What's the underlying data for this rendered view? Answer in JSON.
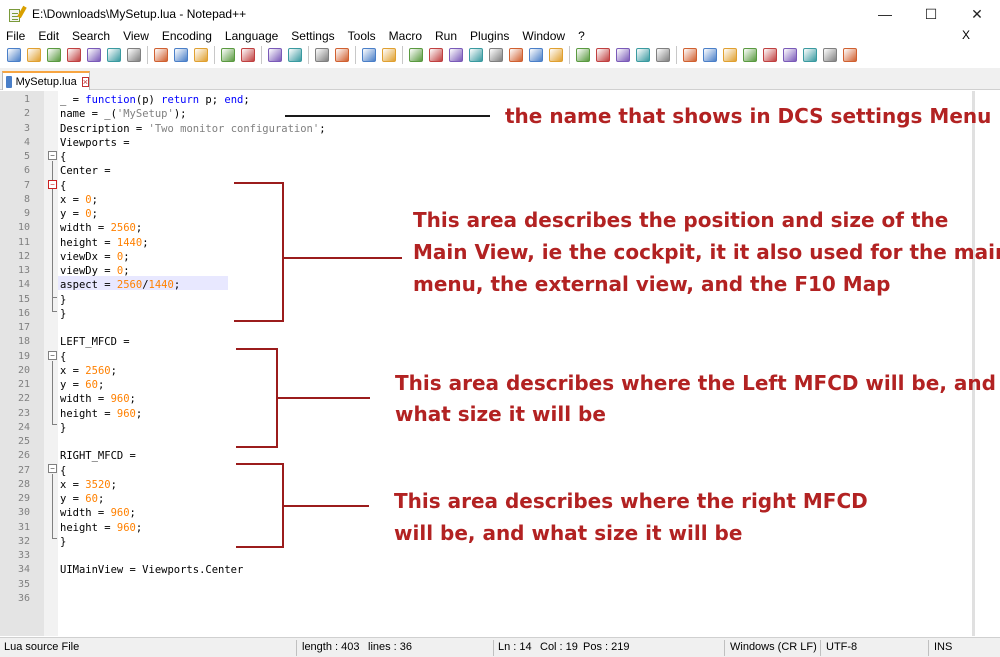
{
  "window": {
    "title": "E:\\Downloads\\MySetup.lua - Notepad++",
    "controls": [
      "—",
      "☐",
      "✕"
    ]
  },
  "menu": {
    "items": [
      "File",
      "Edit",
      "Search",
      "View",
      "Encoding",
      "Language",
      "Settings",
      "Tools",
      "Macro",
      "Run",
      "Plugins",
      "Window",
      "?"
    ],
    "close": "X"
  },
  "toolbar": {
    "icons": [
      "new-file",
      "open-file",
      "save",
      "save-all",
      "close",
      "close-all",
      "print",
      "cut",
      "copy",
      "paste",
      "undo",
      "redo",
      "find",
      "replace",
      "zoom-in",
      "zoom-out",
      "sync-vertical",
      "sync-horizontal",
      "word-wrap",
      "show-all-chars",
      "indent-guide",
      "user-lang",
      "doc-map",
      "function-list",
      "folder-workspace",
      "monitoring",
      "record-macro",
      "stop-macro",
      "play-macro",
      "run-macro-multiple",
      "save-macro",
      "insert-line",
      "hide-lines",
      "lines-block",
      "unfold",
      "collapse",
      "expand",
      "toggle-bookmark",
      "bookmark-list",
      "spellcheck"
    ]
  },
  "tab": {
    "label": "MySetup.lua"
  },
  "editor": {
    "lines": [
      {
        "n": "1",
        "html": "_ = <span class='kw'>function</span>(p) <span class='kw'>return</span> p; <span class='kw'>end</span>;"
      },
      {
        "n": "2",
        "html": "name = _(<span class='str'>'MySetup'</span>);"
      },
      {
        "n": "3",
        "html": "Description = <span class='str'>'Two monitor configuration'</span>;"
      },
      {
        "n": "4",
        "html": "Viewports = "
      },
      {
        "n": "5",
        "html": "{"
      },
      {
        "n": "6",
        "html": "Center = "
      },
      {
        "n": "7",
        "html": "{"
      },
      {
        "n": "8",
        "html": "x = <span class='num'>0</span>;"
      },
      {
        "n": "9",
        "html": "y = <span class='num'>0</span>;"
      },
      {
        "n": "10",
        "html": "width = <span class='num'>2560</span>;"
      },
      {
        "n": "11",
        "html": "height = <span class='num'>1440</span>;"
      },
      {
        "n": "12",
        "html": "viewDx = <span class='num'>0</span>;"
      },
      {
        "n": "13",
        "html": "viewDy = <span class='num'>0</span>;"
      },
      {
        "n": "14",
        "html": "aspect = <span class='num'>2560</span>/<span class='num'>1440</span>;"
      },
      {
        "n": "15",
        "html": "}"
      },
      {
        "n": "16",
        "html": "}"
      },
      {
        "n": "17",
        "html": ""
      },
      {
        "n": "18",
        "html": "LEFT_MFCD = "
      },
      {
        "n": "19",
        "html": "{"
      },
      {
        "n": "20",
        "html": "x = <span class='num'>2560</span>;"
      },
      {
        "n": "21",
        "html": "y = <span class='num'>60</span>;"
      },
      {
        "n": "22",
        "html": "width = <span class='num'>960</span>;"
      },
      {
        "n": "23",
        "html": "height = <span class='num'>960</span>;"
      },
      {
        "n": "24",
        "html": "}"
      },
      {
        "n": "25",
        "html": ""
      },
      {
        "n": "26",
        "html": "RIGHT_MFCD = "
      },
      {
        "n": "27",
        "html": "{"
      },
      {
        "n": "28",
        "html": "x = <span class='num'>3520</span>;"
      },
      {
        "n": "29",
        "html": "y = <span class='num'>60</span>;"
      },
      {
        "n": "30",
        "html": "width = <span class='num'>960</span>;"
      },
      {
        "n": "31",
        "html": "height = <span class='num'>960</span>;"
      },
      {
        "n": "32",
        "html": "}"
      },
      {
        "n": "33",
        "html": ""
      },
      {
        "n": "34",
        "html": "UIMainView = Viewports.Center"
      },
      {
        "n": "35",
        "html": ""
      },
      {
        "n": "36",
        "html": ""
      }
    ]
  },
  "annotations": {
    "name_note": "the name that shows in DCS settings Menu",
    "main_view_lines": [
      "This area describes the position and size of the",
      "Main View, ie the cockpit, it it also used for the main",
      "menu, the external view, and the F10 Map"
    ],
    "left_mfcd_lines": [
      "This area describes where the Left MFCD will be, and",
      "what size it will be"
    ],
    "right_mfcd_lines": [
      "This area describes where the right MFCD",
      "will be, and what size it will be"
    ],
    "color": "#b22222"
  },
  "status": {
    "file_type": "Lua source File",
    "length": "length : 403",
    "lines": "lines : 36",
    "ln": "Ln : 14",
    "col": "Col : 19",
    "pos": "Pos : 219",
    "eol": "Windows (CR LF)",
    "encoding": "UTF-8",
    "mode": "INS"
  }
}
